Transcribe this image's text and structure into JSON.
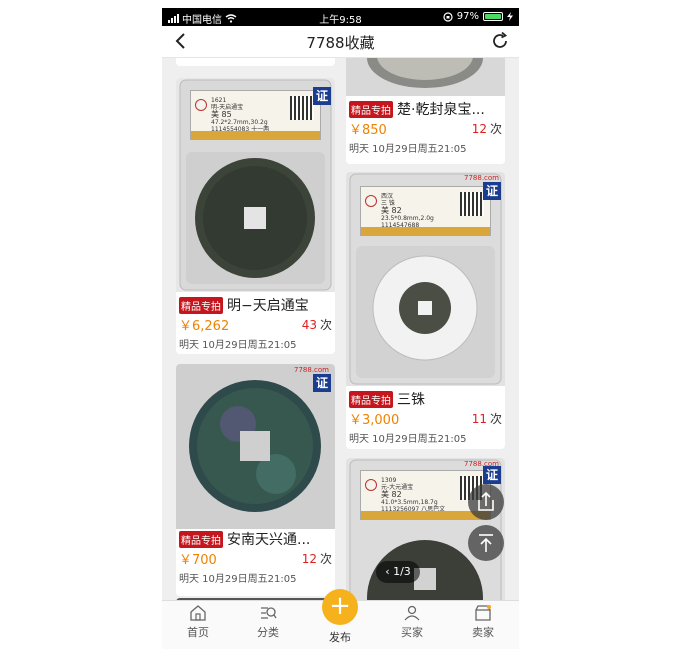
{
  "status_bar": {
    "carrier": "中国电信",
    "time": "上午9:58",
    "battery": "97%",
    "battery_level": 0.97
  },
  "header": {
    "title": "7788收藏",
    "back_icon": "chevron-left-icon",
    "refresh_icon": "refresh-icon"
  },
  "items": [
    {
      "tag": "精品专拍",
      "name": "明−天启通宝",
      "price": "￥6,262",
      "bids": "43",
      "bids_unit": "次",
      "end": "明天 10月29日周五21:05",
      "cert": "证",
      "slab": {
        "year": "1621",
        "title": "明-天启通宝",
        "grade": "美 85",
        "spec": "47.2*2.7mm,30.2g",
        "serial": "1114554083 十一两"
      }
    },
    {
      "tag": "精品专拍",
      "name": "安南天兴通...",
      "price": "￥700",
      "bids": "12",
      "bids_unit": "次",
      "end": "明天 10月29日周五21:05",
      "cert": "证",
      "watermark": "7788.com"
    },
    {
      "tag": "精品专拍",
      "name": "楚·乾封泉宝...",
      "price": "￥850",
      "bids": "12",
      "bids_unit": "次",
      "end": "明天 10月29日周五21:05"
    },
    {
      "tag": "精品专拍",
      "name": "三铢",
      "price": "￥3,000",
      "bids": "11",
      "bids_unit": "次",
      "end": "明天 10月29日周五21:05",
      "cert": "证",
      "watermark": "7788.com",
      "slab": {
        "year": "西汉",
        "title": "三 铢",
        "grade": "美 82",
        "spec": "23.5*0.8mm,2.0g",
        "serial": "1114547688"
      }
    },
    {
      "cert": "证",
      "watermark": "7788.com",
      "slab": {
        "year": "1309",
        "title": "元-大元通宝",
        "grade": "美 82",
        "spec": "41.0*3.5mm,18.7g",
        "serial": "1113256097 八思巴文"
      }
    }
  ],
  "overlay": {
    "pager": "1/3",
    "share_icon": "share-icon",
    "top_icon": "back-to-top-icon"
  },
  "tabbar": {
    "home": "首页",
    "category": "分类",
    "publish": "发布",
    "buyer": "买家",
    "seller": "卖家"
  }
}
